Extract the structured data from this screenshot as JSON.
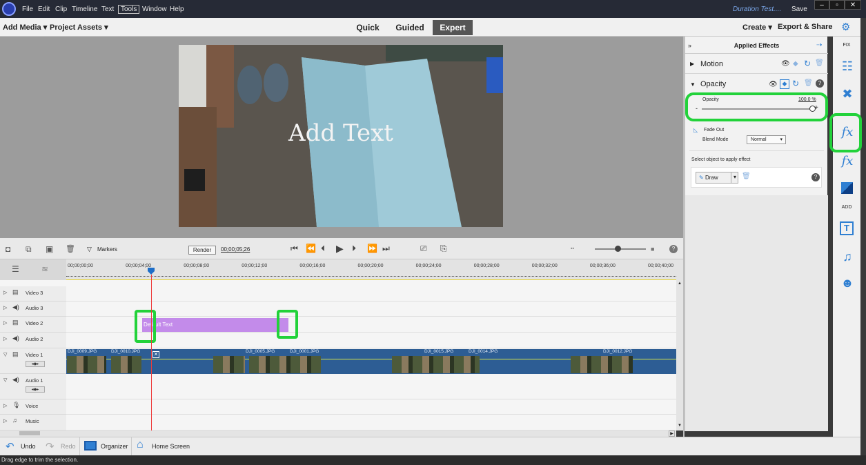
{
  "menubar": {
    "items": [
      "File",
      "Edit",
      "Clip",
      "Timeline",
      "Text",
      "Tools",
      "Window",
      "Help"
    ],
    "project_title": "Duration Test....",
    "save_label": "Save"
  },
  "toolbar": {
    "add_media": "Add Media",
    "project_assets": "Project Assets",
    "modes": [
      "Quick",
      "Guided",
      "Expert"
    ],
    "create": "Create",
    "export_share": "Export & Share"
  },
  "preview": {
    "overlay_text": "Add Text"
  },
  "effects_panel": {
    "title": "Applied Effects",
    "motion_label": "Motion",
    "opacity_section": "Opacity",
    "opacity_label": "Opacity",
    "opacity_value": "100.0",
    "opacity_unit": "%",
    "opacity_level": 1.0,
    "minus": "-",
    "plus": "+",
    "fade_out": "Fade Out",
    "blend_mode_label": "Blend Mode",
    "blend_mode_value": "Normal",
    "select_object_hint": "Select object to apply effect",
    "draw_button": "Draw"
  },
  "right_rail": {
    "fix_label": "FIX",
    "add_label": "ADD",
    "icons": [
      "adjust-icon",
      "tools-icon",
      "applied-effects-icon",
      "effects-icon",
      "transitions-icon",
      "titles-icon",
      "music-icon",
      "graphics-icon"
    ]
  },
  "timeline_bar": {
    "markers_label": "Markers",
    "render_label": "Render",
    "timecode": "00;00;05;26"
  },
  "ruler": {
    "ticks": [
      "00;00;00;00",
      "00;00;04;00",
      "00;00;08;00",
      "00;00;12;00",
      "00;00;16;00",
      "00;00;20;00",
      "00;00;24;00",
      "00;00;28;00",
      "00;00;32;00",
      "00;00;36;00",
      "00;00;40;00"
    ]
  },
  "tracks": {
    "names": [
      "Video 3",
      "Audio 3",
      "Video 2",
      "Audio 2",
      "Video 1",
      "Audio 1",
      "Voice",
      "Music"
    ],
    "text_clip_label": "Default Text",
    "video_clips": [
      "DJI_0009.JPG",
      "DJI_0010.JPG",
      "DJI_0005.JPG",
      "DJI_0001.JPG",
      "DJI_0015.JPG",
      "DJI_0014.JPG",
      "DJI_0012.JPG"
    ]
  },
  "bottom": {
    "undo": "Undo",
    "redo": "Redo",
    "organizer": "Organizer",
    "home_screen": "Home Screen"
  },
  "status_text": "Drag edge to trim the selection."
}
